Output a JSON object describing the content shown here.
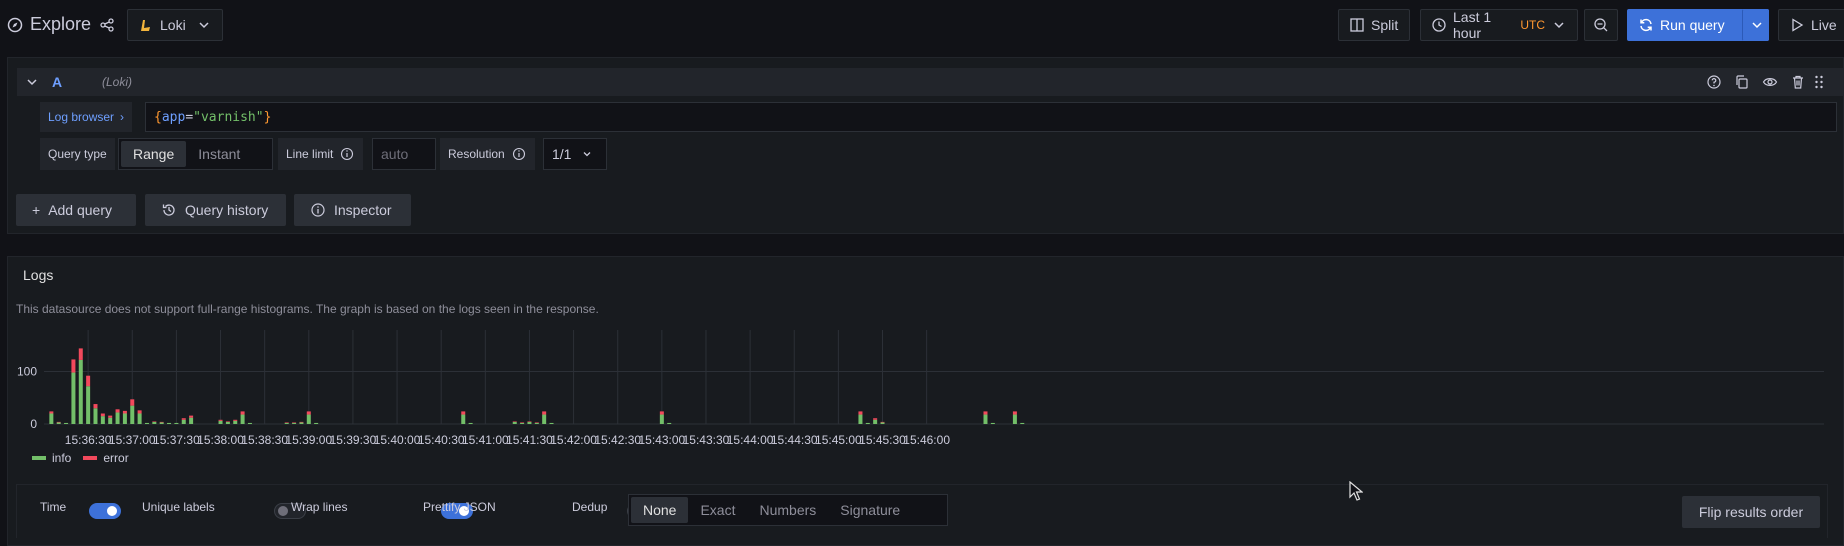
{
  "topbar": {
    "title": "Explore",
    "datasource": "Loki",
    "split_label": "Split",
    "time_range": "Last 1 hour",
    "timezone": "UTC",
    "run_query_label": "Run query",
    "live_label": "Live"
  },
  "query": {
    "ref_id": "A",
    "datasource_hint": "(Loki)",
    "log_browser_label": "Log browser",
    "query_text_open": "{",
    "query_key": "app",
    "query_eq": "=",
    "query_value": "\"varnish\"",
    "query_text_close": "}",
    "query_type_label": "Query type",
    "query_type_options": [
      "Range",
      "Instant"
    ],
    "query_type_selected": "Range",
    "line_limit_label": "Line limit",
    "line_limit_placeholder": "auto",
    "resolution_label": "Resolution",
    "resolution_value": "1/1"
  },
  "actions": {
    "add_query": "Add query",
    "query_history": "Query history",
    "inspector": "Inspector"
  },
  "logs": {
    "title": "Logs",
    "notice": "This datasource does not support full-range histograms. The graph is based on the logs seen in the response.",
    "options": {
      "time_label": "Time",
      "time_on": true,
      "unique_labels_label": "Unique labels",
      "unique_labels_on": false,
      "wrap_lines_label": "Wrap lines",
      "wrap_lines_on": true,
      "prettify_json_label": "Prettify JSON",
      "prettify_json_on": false,
      "dedup_label": "Dedup",
      "dedup_options": [
        "None",
        "Exact",
        "Numbers",
        "Signature"
      ],
      "dedup_selected": "None"
    },
    "flip_label": "Flip results order"
  },
  "colors": {
    "info": "#73bf69",
    "error": "#f2495c",
    "accent": "#3d71d9",
    "timezone": "#ff9830"
  },
  "chart_data": {
    "type": "bar",
    "stacked": true,
    "yticks": [
      "0",
      "100"
    ],
    "ylim": [
      0,
      160
    ],
    "xticks": [
      "15:36:30",
      "15:37:00",
      "15:37:30",
      "15:38:00",
      "15:38:30",
      "15:39:00",
      "15:39:30",
      "15:40:00",
      "15:40:30",
      "15:41:00",
      "15:41:30",
      "15:42:00",
      "15:42:30",
      "15:43:00",
      "15:43:30",
      "15:44:00",
      "15:44:30",
      "15:45:00",
      "15:45:30",
      "15:46:00"
    ],
    "x_seconds_since_15_36_00": [
      5,
      10,
      15,
      20,
      25,
      30,
      35,
      40,
      45,
      50,
      55,
      60,
      65,
      70,
      75,
      80,
      85,
      90,
      95,
      100,
      105,
      110,
      115,
      120,
      125,
      130,
      135,
      140,
      145,
      150,
      155,
      160,
      165,
      170,
      175,
      180,
      185,
      190,
      195,
      200,
      205,
      210,
      215,
      220,
      225,
      230,
      235,
      240,
      245,
      250,
      255,
      260,
      265,
      270,
      275,
      280,
      285,
      290,
      295,
      300,
      305,
      310,
      315,
      320,
      325,
      330,
      335,
      340,
      345,
      350,
      355,
      360,
      365,
      370,
      375,
      380,
      385,
      390,
      395,
      400,
      405,
      410,
      415,
      420,
      425,
      430,
      435,
      440,
      445,
      450,
      455,
      460,
      465,
      470,
      475,
      480,
      485,
      490,
      495,
      500,
      505,
      510,
      515,
      520,
      525,
      530,
      535,
      540,
      545,
      550,
      555,
      560,
      565,
      570,
      575,
      580,
      585,
      590,
      595,
      600,
      605,
      610,
      615,
      620,
      625,
      630,
      635,
      640,
      645,
      650,
      655,
      660,
      665,
      670,
      675,
      680,
      685,
      690,
      695,
      700,
      705,
      710,
      715,
      720,
      725,
      730,
      735,
      740,
      745,
      750,
      755,
      760,
      765,
      770,
      775,
      780,
      785,
      790,
      795,
      800,
      805,
      810,
      815,
      820,
      825,
      830,
      835,
      840,
      845,
      850,
      855,
      860,
      865,
      870,
      875,
      880,
      885,
      890,
      895,
      900,
      905,
      910,
      915,
      920,
      925,
      930,
      935,
      940,
      945,
      950,
      955,
      960,
      965,
      970,
      975,
      980,
      985,
      990,
      995,
      1000,
      1005,
      1010,
      1015,
      1020,
      1025,
      1030,
      1035,
      1040,
      1045,
      1050,
      1055,
      1060,
      1065,
      1070,
      1075,
      1080,
      1085,
      1090,
      1095,
      1100,
      1105,
      1110,
      1115,
      1120,
      1125,
      1130,
      1135,
      1140,
      1145,
      1150,
      1155,
      1160,
      1165,
      1170,
      1175,
      1180,
      1185,
      1190,
      1195,
      1200
    ],
    "series": [
      {
        "name": "info",
        "values": [
          20,
          3,
          2,
          98,
          122,
          72,
          30,
          15,
          12,
          22,
          20,
          35,
          20,
          2,
          4,
          3,
          2,
          2,
          8,
          12,
          0,
          0,
          0,
          6,
          4,
          6,
          18,
          2,
          0,
          0,
          0,
          0,
          2,
          2,
          3,
          18,
          2,
          0,
          0,
          0,
          0,
          0,
          0,
          0,
          0,
          0,
          0,
          0,
          0,
          0,
          0,
          0,
          0,
          0,
          0,
          0,
          18,
          2,
          0,
          0,
          0,
          0,
          0,
          4,
          2,
          4,
          2,
          18,
          2,
          0,
          0,
          0,
          0,
          0,
          0,
          0,
          0,
          0,
          0,
          0,
          0,
          0,
          0,
          18,
          2,
          0,
          0,
          0,
          0,
          0,
          0,
          0,
          0,
          0,
          0,
          0,
          0,
          0,
          0,
          0,
          0,
          0,
          0,
          0,
          0,
          0,
          0,
          0,
          0,
          0,
          18,
          2,
          8,
          3,
          0,
          0,
          0,
          0,
          0,
          0,
          0,
          0,
          0,
          0,
          0,
          0,
          0,
          18,
          2,
          0,
          0,
          18,
          2,
          0,
          0,
          0,
          0,
          0,
          0,
          0,
          0,
          0,
          0,
          0,
          0,
          0,
          0,
          0,
          0,
          0,
          0,
          0,
          0,
          0,
          0,
          0,
          0,
          0,
          0,
          0,
          0,
          0,
          0,
          0,
          0,
          0,
          0,
          0,
          0,
          0,
          0,
          0,
          0,
          0,
          0,
          0,
          0,
          0,
          0,
          0,
          0,
          0,
          0,
          0,
          0,
          0,
          0,
          0,
          0,
          0,
          0,
          0,
          0,
          0,
          0,
          0,
          0,
          0,
          0,
          0,
          0,
          0,
          0,
          0,
          0,
          0,
          0,
          0,
          0,
          0,
          0,
          0,
          0,
          0,
          0,
          0,
          0,
          0,
          0,
          0,
          0,
          0,
          0,
          0,
          0,
          0,
          0,
          0,
          0,
          0,
          0,
          0,
          0,
          0,
          0,
          0,
          0,
          0,
          0
        ]
      },
      {
        "name": "error",
        "values": [
          4,
          1,
          0,
          25,
          22,
          20,
          8,
          5,
          4,
          6,
          5,
          12,
          6,
          0,
          1,
          1,
          0,
          0,
          3,
          4,
          0,
          0,
          0,
          2,
          1,
          2,
          6,
          0,
          0,
          0,
          0,
          0,
          1,
          1,
          1,
          6,
          0,
          0,
          0,
          0,
          0,
          0,
          0,
          0,
          0,
          0,
          0,
          0,
          0,
          0,
          0,
          0,
          0,
          0,
          0,
          0,
          6,
          0,
          0,
          0,
          0,
          0,
          0,
          1,
          1,
          1,
          1,
          6,
          0,
          0,
          0,
          0,
          0,
          0,
          0,
          0,
          0,
          0,
          0,
          0,
          0,
          0,
          0,
          6,
          0,
          0,
          0,
          0,
          0,
          0,
          0,
          0,
          0,
          0,
          0,
          0,
          0,
          0,
          0,
          0,
          0,
          0,
          0,
          0,
          0,
          0,
          0,
          0,
          0,
          0,
          6,
          0,
          3,
          1,
          0,
          0,
          0,
          0,
          0,
          0,
          0,
          0,
          0,
          0,
          0,
          0,
          0,
          6,
          0,
          0,
          0,
          6,
          0,
          0,
          0,
          0,
          0,
          0,
          0,
          0,
          0,
          0,
          0,
          0,
          0,
          0,
          0,
          0,
          0,
          0,
          0,
          0,
          0,
          0,
          0,
          0,
          0,
          0,
          0,
          0,
          0,
          0,
          0,
          0,
          0,
          0,
          0,
          0,
          0,
          0,
          0,
          0,
          0,
          0,
          0,
          0,
          0,
          0,
          0,
          0,
          0,
          0,
          0,
          0,
          0,
          0,
          0,
          0,
          0,
          0,
          0,
          0,
          0,
          0,
          0,
          0,
          0,
          0,
          0,
          0,
          0,
          0,
          0,
          0,
          0,
          0,
          0,
          0,
          0,
          0,
          0,
          0,
          0,
          0,
          0,
          0,
          0,
          0,
          0,
          0,
          0,
          0,
          0,
          0,
          0,
          0,
          0,
          0,
          0,
          0,
          0,
          0,
          0,
          0,
          0,
          0,
          0,
          0,
          0,
          0
        ]
      }
    ],
    "legend": [
      "info",
      "error"
    ],
    "legend_position": "bottom-left"
  }
}
